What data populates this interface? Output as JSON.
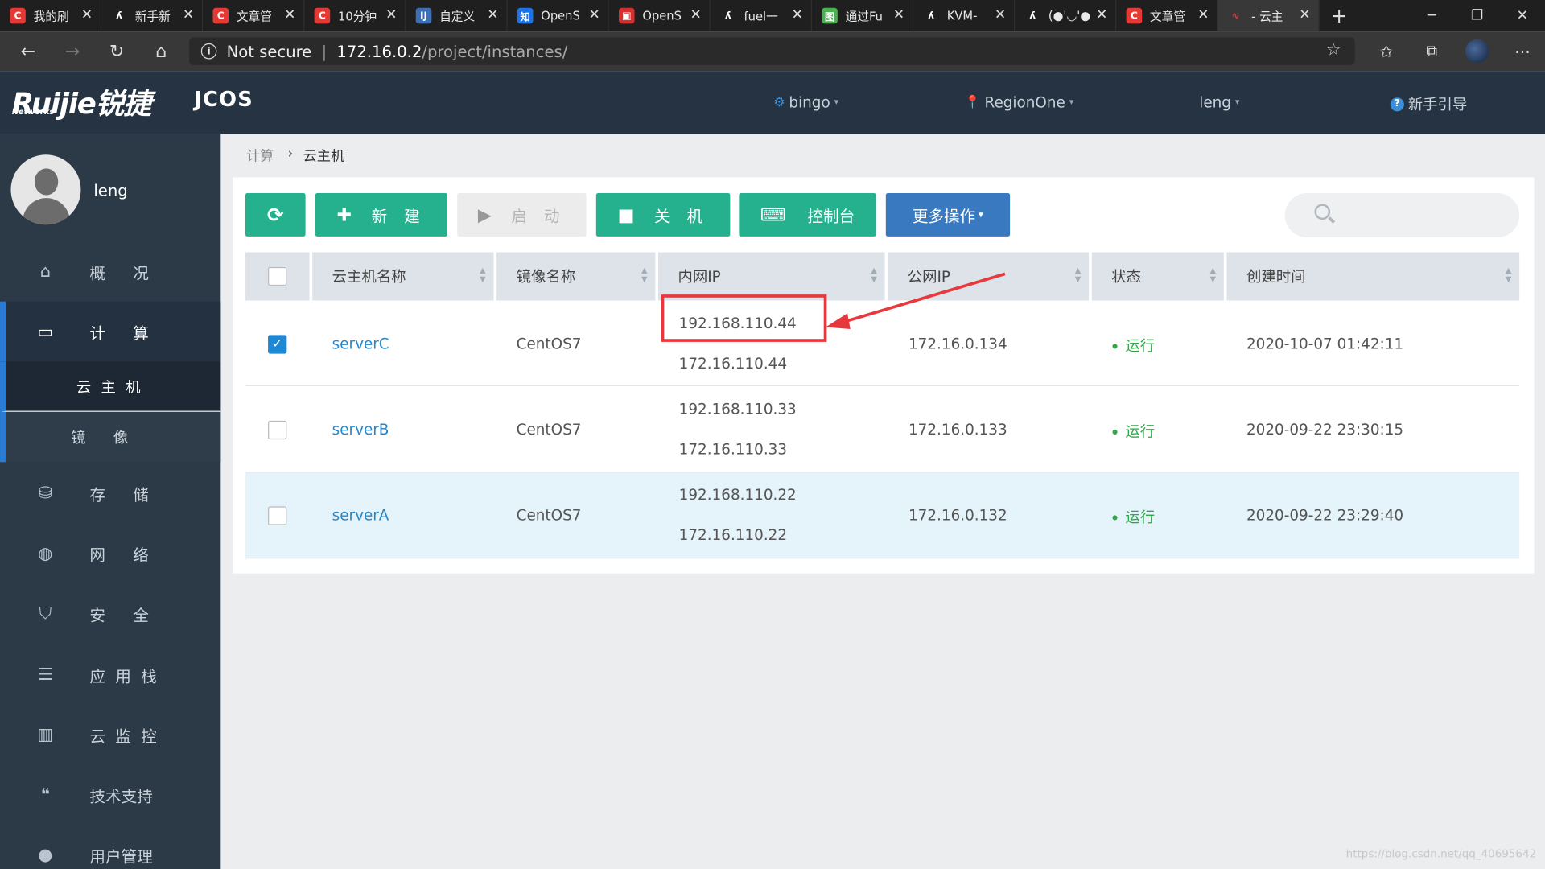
{
  "browser": {
    "tabs": [
      {
        "label": "我的刷",
        "icon": "C",
        "icon_color": "#e53935"
      },
      {
        "label": "新手新",
        "icon": "ʎ",
        "icon_color": "#1f1f1f"
      },
      {
        "label": "文章管",
        "icon": "C",
        "icon_color": "#e53935"
      },
      {
        "label": "10分钟",
        "icon": "C",
        "icon_color": "#e53935"
      },
      {
        "label": "自定义",
        "icon": "IJ",
        "icon_color": "#3d6fb5"
      },
      {
        "label": "OpenS",
        "icon": "知",
        "icon_color": "#1a73e8"
      },
      {
        "label": "OpenS",
        "icon": "▣",
        "icon_color": "#d32f2f"
      },
      {
        "label": "fuel一",
        "icon": "ʎ",
        "icon_color": "#1f1f1f"
      },
      {
        "label": "通过Fu",
        "icon": "图",
        "icon_color": "#4caf50"
      },
      {
        "label": "KVM-",
        "icon": "ʎ",
        "icon_color": "#1f1f1f"
      },
      {
        "label": "(●'◡'●",
        "icon": "ʎ",
        "icon_color": "#1f1f1f"
      },
      {
        "label": "文章管",
        "icon": "C",
        "icon_color": "#e53935"
      },
      {
        "label": "- 云主",
        "icon": "∿",
        "icon_color": "#383838"
      }
    ],
    "new_tab": "+",
    "window_controls": {
      "minimize": "─",
      "maximize": "❐",
      "close": "✕"
    },
    "nav": {
      "back": "←",
      "forward": "→",
      "reload": "↻",
      "home": "⌂"
    },
    "security_label": "Not secure",
    "url_host": "172.16.0.2",
    "url_path": "/project/instances/",
    "icons": {
      "star": "☆",
      "favorites": "✩",
      "collections": "⧉",
      "more": "⋯"
    }
  },
  "header": {
    "logo_text": "Ruijie锐捷",
    "logo_sub": "Networks",
    "product": "JCOS",
    "project": "bingo",
    "region": "RegionOne",
    "user": "leng",
    "guide": "新手引导",
    "accent": "#3b8fd9"
  },
  "sidebar": {
    "user_name": "leng",
    "items": [
      {
        "label": "概况",
        "icon": "home-icon",
        "glyph": "⌂"
      },
      {
        "label": "计算",
        "icon": "monitor-icon",
        "glyph": "▭"
      },
      {
        "label": "存储",
        "icon": "drive-icon",
        "glyph": "⛁"
      },
      {
        "label": "网络",
        "icon": "globe-icon",
        "glyph": "◍"
      },
      {
        "label": "安全",
        "icon": "shield-icon",
        "glyph": "⛉"
      },
      {
        "label": "应用栈",
        "icon": "stack-icon",
        "glyph": "☰"
      },
      {
        "label": "云监控",
        "icon": "chart-icon",
        "glyph": "▥"
      },
      {
        "label": "技术支持",
        "icon": "chat-icon",
        "glyph": "❝"
      },
      {
        "label": "用户管理",
        "icon": "user-icon",
        "glyph": "●"
      }
    ],
    "sub_items": [
      {
        "label": "云主机"
      },
      {
        "label": "镜像"
      }
    ]
  },
  "breadcrumb": {
    "parent": "计算",
    "current": "云主机"
  },
  "toolbar": {
    "refresh_icon": "⟳",
    "create_label": "新 建",
    "create_icon": "✚",
    "start_label": "启 动",
    "start_icon": "▶",
    "shutdown_label": "关 机",
    "shutdown_icon": "■",
    "console_label": "控制台",
    "console_icon": "⌨",
    "more_label": "更多操作",
    "more_caret": "▾",
    "search_placeholder": ""
  },
  "table": {
    "columns": [
      "云主机名称",
      "镜像名称",
      "内网IP",
      "公网IP",
      "状态",
      "创建时间"
    ],
    "rows": [
      {
        "checked": true,
        "name": "serverC",
        "image": "CentOS7",
        "ip1": "192.168.110.44",
        "ip2": "172.16.110.44",
        "public_ip": "172.16.0.134",
        "status": "运行",
        "created": "2020-10-07 01:42:11"
      },
      {
        "checked": false,
        "name": "serverB",
        "image": "CentOS7",
        "ip1": "192.168.110.33",
        "ip2": "172.16.110.33",
        "public_ip": "172.16.0.133",
        "status": "运行",
        "created": "2020-09-22 23:30:15"
      },
      {
        "checked": false,
        "name": "serverA",
        "image": "CentOS7",
        "ip1": "192.168.110.22",
        "ip2": "172.16.110.22",
        "public_ip": "172.16.0.132",
        "status": "运行",
        "created": "2020-09-22 23:29:40"
      }
    ]
  },
  "watermark": "https://blog.csdn.net/qq_40695642",
  "colors": {
    "green": "#25b08e",
    "blue": "#3979c0",
    "annotation": "#e8383d",
    "status": "#30a84a"
  }
}
